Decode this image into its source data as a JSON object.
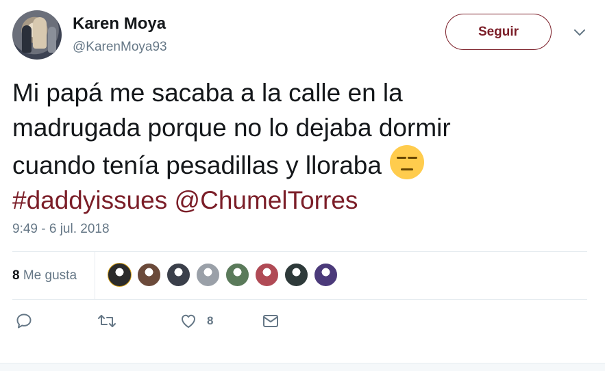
{
  "author": {
    "name": "Karen Moya",
    "handle": "@KarenMoya93"
  },
  "follow_button": {
    "label": "Seguir"
  },
  "tweet": {
    "lines": [
      "Mi papá me sacaba a la calle en la",
      "madrugada porque no lo dejaba dormir",
      "cuando tenía pesadillas y lloraba"
    ],
    "emoji": "expressionless-face",
    "hashtag": "#daddyissues",
    "mention": "@ChumelTorres",
    "timestamp": "9:49 - 6 jul. 2018"
  },
  "stats": {
    "likes_count": "8",
    "likes_label": "Me gusta"
  },
  "likers": [
    {
      "color": "#2b2b2b",
      "ring": "#d4a017"
    },
    {
      "color": "#6b4a3a"
    },
    {
      "color": "#3a3f4a"
    },
    {
      "color": "#9aa0a8"
    },
    {
      "color": "#5a7a5a"
    },
    {
      "color": "#b04a55"
    },
    {
      "color": "#2e3a3a"
    },
    {
      "color": "#4b3a7a"
    }
  ],
  "actions": {
    "reply": {
      "icon": "reply-icon"
    },
    "retweet": {
      "icon": "retweet-icon"
    },
    "like": {
      "icon": "heart-icon",
      "count": "8"
    },
    "dm": {
      "icon": "envelope-icon"
    }
  },
  "colors": {
    "accent": "#7b1e28",
    "secondary_text": "#657786",
    "divider": "#e6ecf0"
  }
}
